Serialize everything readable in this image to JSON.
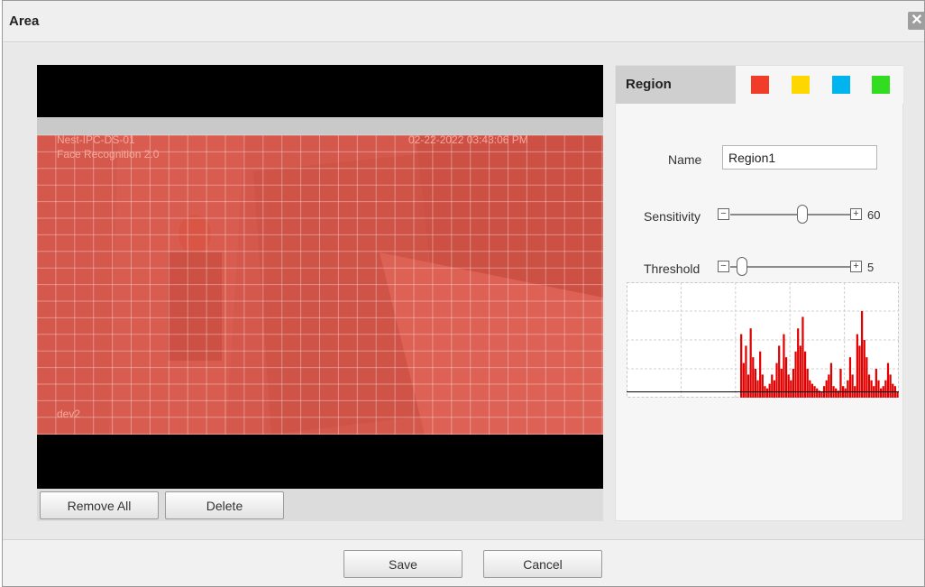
{
  "dialog": {
    "title": "Area",
    "close_icon": "close-icon (×)"
  },
  "video": {
    "osd_line1": "Nest-IPC-DS-01",
    "osd_line2": "Face Recognition 2.0",
    "timestamp": "02-22-2022 03:43:06 PM",
    "channel_label": "dev2",
    "overlay_color": "#f2594b"
  },
  "buttons": {
    "remove_all": "Remove All",
    "delete": "Delete",
    "save": "Save",
    "cancel": "Cancel"
  },
  "region_panel": {
    "tab_label": "Region",
    "swatches": [
      {
        "name": "red",
        "color": "#f03c28",
        "selected": true
      },
      {
        "name": "yellow",
        "color": "#ffd700",
        "selected": false
      },
      {
        "name": "blue",
        "color": "#00b4f0",
        "selected": false
      },
      {
        "name": "green",
        "color": "#32dc1e",
        "selected": false
      }
    ],
    "name_label": "Name",
    "name_value": "Region1",
    "sensitivity_label": "Sensitivity",
    "sensitivity_value": "60",
    "sensitivity_fraction": 0.6,
    "threshold_label": "Threshold",
    "threshold_value": "5",
    "threshold_fraction": 0.05,
    "minus_icon": "minus-icon",
    "plus_icon": "plus-icon"
  },
  "chart_data": {
    "type": "bar",
    "title": "",
    "xlabel": "",
    "ylabel": "",
    "ylim": [
      0,
      100
    ],
    "threshold": 5,
    "series": [
      {
        "values": [
          0,
          0,
          0,
          0,
          0,
          0,
          0,
          0,
          0,
          0,
          0,
          0,
          0,
          0,
          0,
          0,
          0,
          0,
          0,
          0,
          0,
          0,
          0,
          0,
          0,
          0,
          0,
          0,
          0,
          0,
          0,
          0,
          0,
          0,
          0,
          0,
          0,
          0,
          0,
          0,
          0,
          0,
          0,
          0,
          0,
          0,
          0,
          0,
          55,
          30,
          45,
          20,
          60,
          35,
          25,
          15,
          40,
          20,
          10,
          8,
          12,
          20,
          15,
          30,
          45,
          25,
          55,
          35,
          20,
          15,
          25,
          40,
          60,
          45,
          70,
          40,
          25,
          15,
          12,
          10,
          8,
          6,
          5,
          10,
          15,
          20,
          30,
          10,
          8,
          6,
          25,
          10,
          8,
          15,
          35,
          20,
          10,
          55,
          45,
          75,
          50,
          35,
          20,
          15,
          10,
          25,
          15,
          8,
          10,
          15,
          30,
          20,
          12,
          10,
          5
        ]
      },
      {
        "values": [
          0,
          0,
          0,
          0,
          0,
          0,
          0,
          0,
          0,
          0,
          0,
          0,
          0,
          0,
          0,
          0,
          0,
          0,
          0,
          0,
          0,
          0,
          0,
          0,
          0,
          0,
          0,
          0,
          0,
          0,
          0,
          0,
          0,
          0,
          0,
          0,
          0,
          0,
          0,
          0,
          0,
          0,
          0,
          0,
          0,
          0,
          0,
          0,
          0,
          0,
          0,
          0,
          0,
          0,
          0,
          0,
          0,
          0,
          0,
          0,
          0,
          0,
          0,
          0,
          0,
          0,
          0,
          0,
          0,
          0,
          0,
          0,
          0,
          0,
          0,
          0,
          0,
          0,
          0,
          0,
          0,
          0,
          0,
          0,
          0,
          0,
          0,
          0,
          0,
          0,
          0,
          0,
          0,
          0,
          0,
          0,
          0,
          0,
          0,
          0,
          0,
          0,
          0,
          0,
          0,
          0,
          0,
          0,
          0,
          0,
          0,
          0,
          0,
          0,
          0,
          0
        ]
      }
    ]
  }
}
